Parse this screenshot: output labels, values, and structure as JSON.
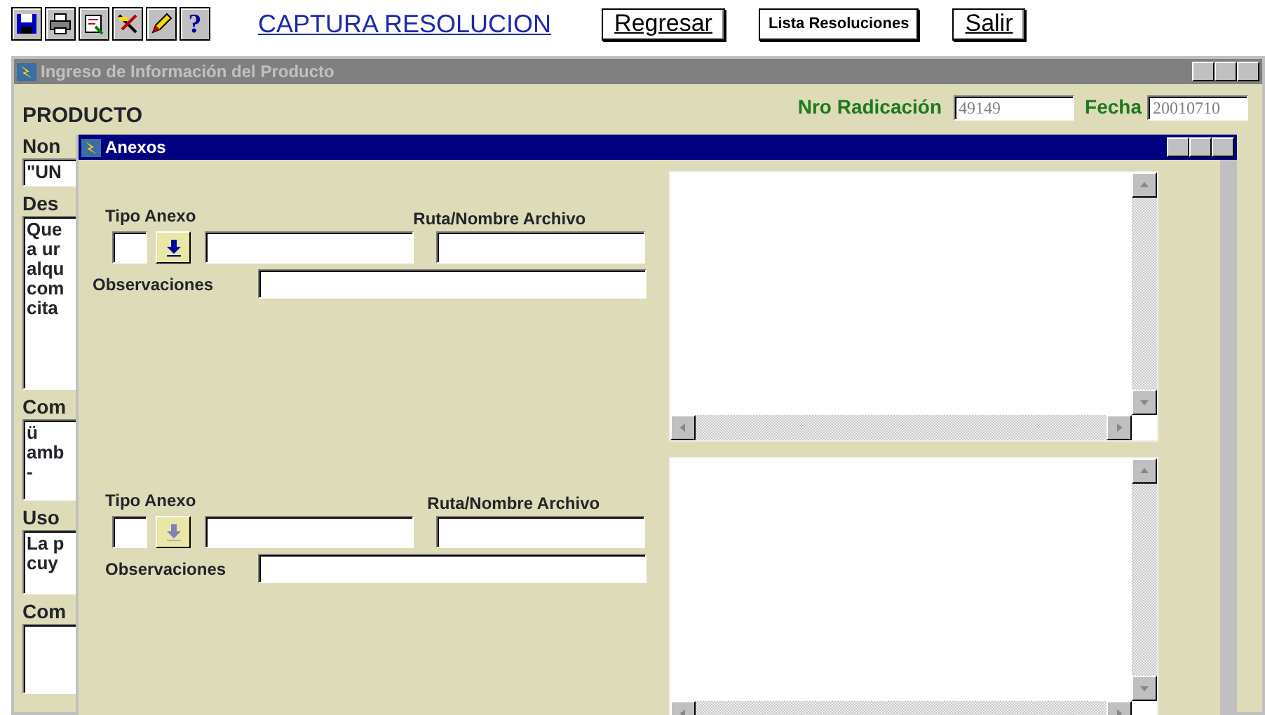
{
  "toolbar": {
    "icons": [
      {
        "kind": "save"
      },
      {
        "kind": "print"
      },
      {
        "kind": "preview"
      },
      {
        "kind": "tools"
      },
      {
        "kind": "edit"
      },
      {
        "kind": "help",
        "glyph": "?"
      }
    ],
    "title": "CAPTURA RESOLUCION",
    "buttons": [
      "Regresar",
      "Lista Resoluciones",
      "Salir"
    ]
  },
  "main_window": {
    "title": "Ingreso de Información del Producto",
    "active": false,
    "section": "PRODUCTO",
    "nro_radicacion": {
      "label": "Nro Radicación",
      "value": "49149"
    },
    "fecha": {
      "label": "Fecha",
      "value": "20010710"
    },
    "fields": [
      {
        "label": "Non",
        "lines": [
          "\"UN"
        ]
      },
      {
        "label": "Des",
        "lines": [
          "Que",
          "a ur",
          "alqu",
          "com",
          "cita"
        ]
      },
      {
        "label": "Com",
        "lines": [
          "ü",
          "amb",
          "-"
        ]
      },
      {
        "label": "Uso",
        "lines": [
          "La p",
          "cuy"
        ]
      },
      {
        "label": "Com"
      }
    ]
  },
  "dialog": {
    "title": "Anexos",
    "active": true,
    "records": [
      {
        "tipo_label": "Tipo Anexo",
        "ruta_label": "Ruta/Nombre Archivo",
        "obs_label": "Observaciones",
        "lookup_disabled": false
      },
      {
        "tipo_label": "Tipo Anexo",
        "ruta_label": "Ruta/Nombre Archivo",
        "obs_label": "Observaciones",
        "lookup_disabled": true
      }
    ]
  }
}
